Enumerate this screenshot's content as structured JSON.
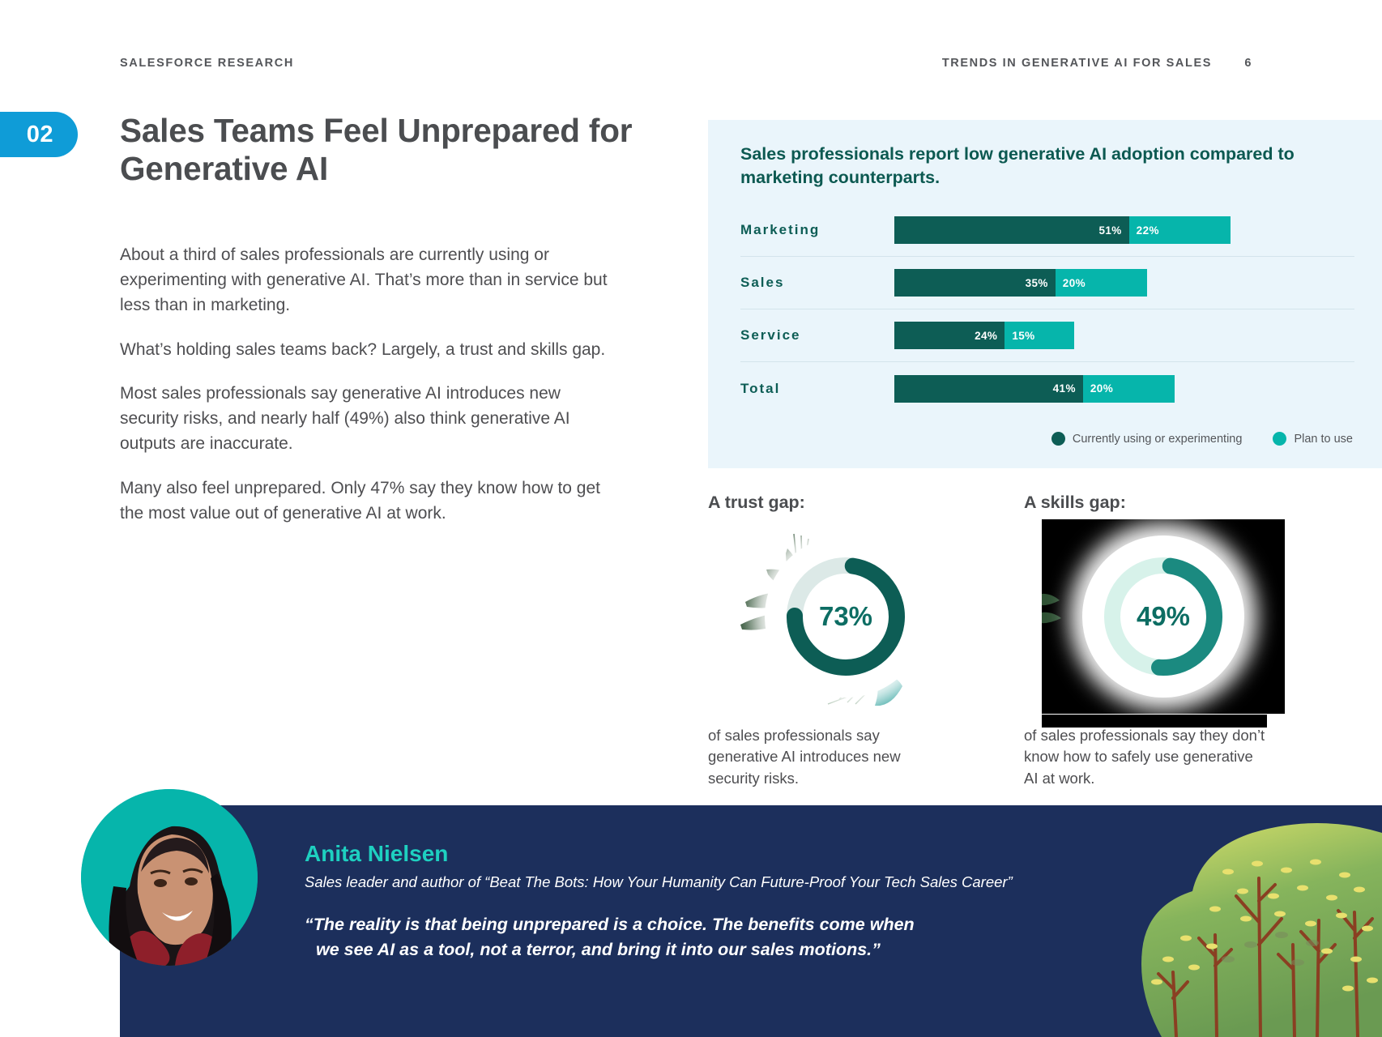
{
  "header": {
    "left": "SALESFORCE RESEARCH",
    "right": "TRENDS IN GENERATIVE AI FOR SALES",
    "page": "6"
  },
  "section": {
    "number": "02",
    "title": "Sales Teams Feel Unprepared for Generative AI"
  },
  "body": {
    "paragraphs": [
      "About a third of sales professionals are currently using or experimenting with generative AI. That’s more than in service but less than in marketing.",
      "What’s holding sales teams back? Largely, a trust and skills gap.",
      "Most sales professionals say generative AI introduces new security risks, and nearly half (49%) also think generative AI outputs are inaccurate.",
      "Many also feel unprepared. Only 47% say they know how to get the most value out of generative AI at work."
    ]
  },
  "chart_data": {
    "type": "bar",
    "title": "Sales professionals report low generative AI adoption compared to marketing counterparts.",
    "orientation": "horizontal",
    "stacked": true,
    "categories": [
      "Marketing",
      "Sales",
      "Service",
      "Total"
    ],
    "series": [
      {
        "name": "Currently using or experimenting",
        "color": "#0d5d55",
        "values": [
          51,
          35,
          24,
          41
        ],
        "labels": [
          "51%",
          "35%",
          "24%",
          "41%"
        ]
      },
      {
        "name": "Plan to use",
        "color": "#06b5ab",
        "values": [
          22,
          20,
          15,
          20
        ],
        "labels": [
          "22%",
          "20%",
          "15%",
          "20%"
        ]
      }
    ],
    "xlabel": "",
    "ylabel": "",
    "xlim": [
      0,
      100
    ],
    "grid": false,
    "legend_position": "bottom-right",
    "units": "percent"
  },
  "gaps": [
    {
      "heading": "A trust gap:",
      "value": "73%",
      "percent": 73,
      "caption": "of sales professionals say generative AI introduces new security risks."
    },
    {
      "heading": "A skills gap:",
      "value": "49%",
      "percent": 49,
      "caption": "of sales professionals say they don’t know how to safely use generative AI at work."
    }
  ],
  "quote": {
    "name": "Anita Nielsen",
    "subtitle": "Sales leader and author of “Beat The Bots: How Your Humanity Can Future-Proof Your Tech Sales Career”",
    "line1": "“The reality is that being unprepared is a choice. The benefits come when",
    "line2": "we see AI as a tool, not a terror, and bring it into our sales motions.”"
  },
  "colors": {
    "badge_blue": "#0f9cd7",
    "dark_teal": "#0d5d55",
    "bright_teal": "#06b5ab",
    "panel_bg": "#eaf5fb",
    "navy": "#1c2f5c",
    "text_gray": "#4e4e51"
  }
}
